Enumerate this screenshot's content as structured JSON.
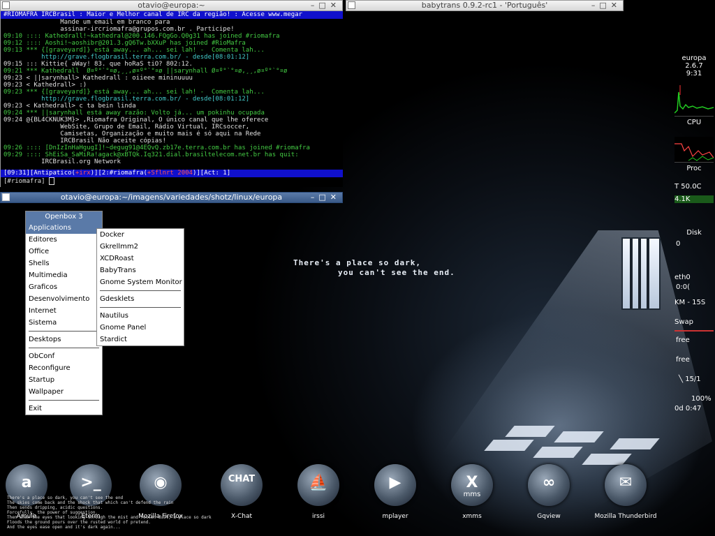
{
  "terminal1": {
    "title": "otavio@europa:~",
    "topic": " #RIOMAFRA IRCBrasil : Maior e Melhor canal de IRC da região! : Acesse www.megar",
    "lines": [
      "               Mande um email em branco para",
      "               assinar-ircriomafra@grupos.com.br . Participe!",
      "09:10 :::: Kathedrall!~kathedral@200.146.FQgGo.Q0g31 has joined #riomafra",
      "09:12 :::: Aoshi!~aoshibr@201.3.gQ6Tw.bXXuP has joined #RioMafra",
      "09:13 *** {[graveyard]} está away... ah... sei lah! -  Comenta lah...",
      "          http://grave.flogbrasil.terra.com.br/ - desde[08:01:12]",
      "09:15 ::: Kittie{ aWay! 83. que hoRaS tiO? 802:12.",
      "09:21 *** Kathedrall  Ø¤º°`°¤ø,¸¸,ø¤º°`°¤ø ||sarynhall Ø¤º°`°¤ø,¸¸,ø¤º°`°¤ø",
      "09:23 < ||sarynhall> Kathedrall : oiieee mininuuuu",
      "09:23 < Kathedrall> :)",
      "09:23 *** {[graveyard]} está away... ah... sei lah! -  Comenta lah...",
      "          http://grave.flogbrasil.terra.com.br/ - desde[08:01:12]",
      "09:23 < Kathedrall> c ta bein linda",
      "09:24 *** ||sarynhall está away razão: Volto já... um pokinhu ocupada",
      "09:24 @{BL4CKNUK3M}> ,Riomafra Original, O único canal que lhe oferece",
      "               WebSite, Grupo de Email, Rádio Virtual, IRCsoccer,",
      "               Camisetas, Organização e muito mais é só aqui na Rede",
      "               IRCBrasil Não aceite cópias!",
      "09:26 :::: [DnIzInHaHgugI]!~degug91@4EQvQ.zb17e.terra.com.br has joined #riomafra",
      "09:29 :::: ShEiSa_SaMiRa!agack@xBTQk.Iq321.dial.brasiltelecom.net.br has quit:",
      "          IRCBrasil.org Network"
    ],
    "status_a": "[09:31][Antipatico(",
    "status_b": "+irx",
    "status_c": ")][2:#riomafra(",
    "status_d": "+Sflnrt 2004",
    "status_e": ")][Act: 1]",
    "prompt": "[#riomafra] "
  },
  "window2": {
    "title": "babytrans 0.9.2-rc1 - 'Português'"
  },
  "terminal2": {
    "title": "otavio@europa:~/imagens/variedades/shotz/linux/europa"
  },
  "openbox_menu": {
    "title": "Openbox 3",
    "items": [
      "Applications",
      "Editores",
      "Office",
      "Shells",
      "Multimedia",
      "Graficos",
      "Desenvolvimento",
      "Internet",
      "Sistema"
    ],
    "items2": [
      "Desktops"
    ],
    "items3": [
      "ObConf",
      "Reconfigure",
      "Startup",
      "Wallpaper"
    ],
    "items4": [
      "Exit"
    ]
  },
  "submenu": {
    "group1": [
      "Docker",
      "Gkrellmm2",
      "XCDRoast",
      "BabyTrans",
      "Gnome System Monitor"
    ],
    "group2": [
      "Gdesklets"
    ],
    "group3": [
      "Nautilus",
      "Gnome Panel",
      "Stardict"
    ]
  },
  "monitor": {
    "host": "europa",
    "kernel": "2.6.7",
    "clock": "9:31",
    "cpu": "CPU",
    "proc": "Proc",
    "temp": "T 50.0C",
    "size": "4.1K",
    "disk": "Disk",
    "disk_val": "0",
    "eth": "eth0",
    "eth_val": "0:0(",
    "eth_rate": "KM - 15S",
    "swap": "Swap",
    "free1": "free",
    "free2": "free",
    "procs": "╲ 15/1",
    "batt": "100%",
    "uptime": "0d 0:47"
  },
  "quote": {
    "line1": "There's a place so dark,",
    "line2": "you can't see the end."
  },
  "poem": [
    "There's a place so dark, you can't see the end",
    "The skies come back and the shock that which can't defend the rain",
    "Then sends dripping, acidic questions.",
    "Forcefully, the power of suggestion.",
    "Then when the eyes that looking through the mist and rotten dust, a place so dark",
    "Floods the ground pours over the rusted world of pretend.",
    "And the eyes ease open and it's dark again..."
  ],
  "dock": [
    {
      "label": "Amule",
      "icon": "amule-icon",
      "glyph": "a"
    },
    {
      "label": "Eterm",
      "icon": "terminal-icon",
      "glyph": ">_"
    },
    {
      "label": "Mozilla Firefox",
      "icon": "firefox-icon",
      "glyph": "◉"
    },
    {
      "label": "X-Chat",
      "icon": "xchat-icon",
      "glyph": "CHAT"
    },
    {
      "label": "irssi",
      "icon": "irssi-icon",
      "glyph": "⛵"
    },
    {
      "label": "mplayer",
      "icon": "mplayer-icon",
      "glyph": "▶"
    },
    {
      "label": "xmms",
      "icon": "xmms-icon",
      "glyph": "X"
    },
    {
      "label": "Gqview",
      "icon": "gqview-icon",
      "glyph": "∞"
    },
    {
      "label": "Mozilla Thunderbird",
      "icon": "thunderbird-icon",
      "glyph": "✉"
    }
  ],
  "dock_sub": {
    "xmms": "mms"
  }
}
